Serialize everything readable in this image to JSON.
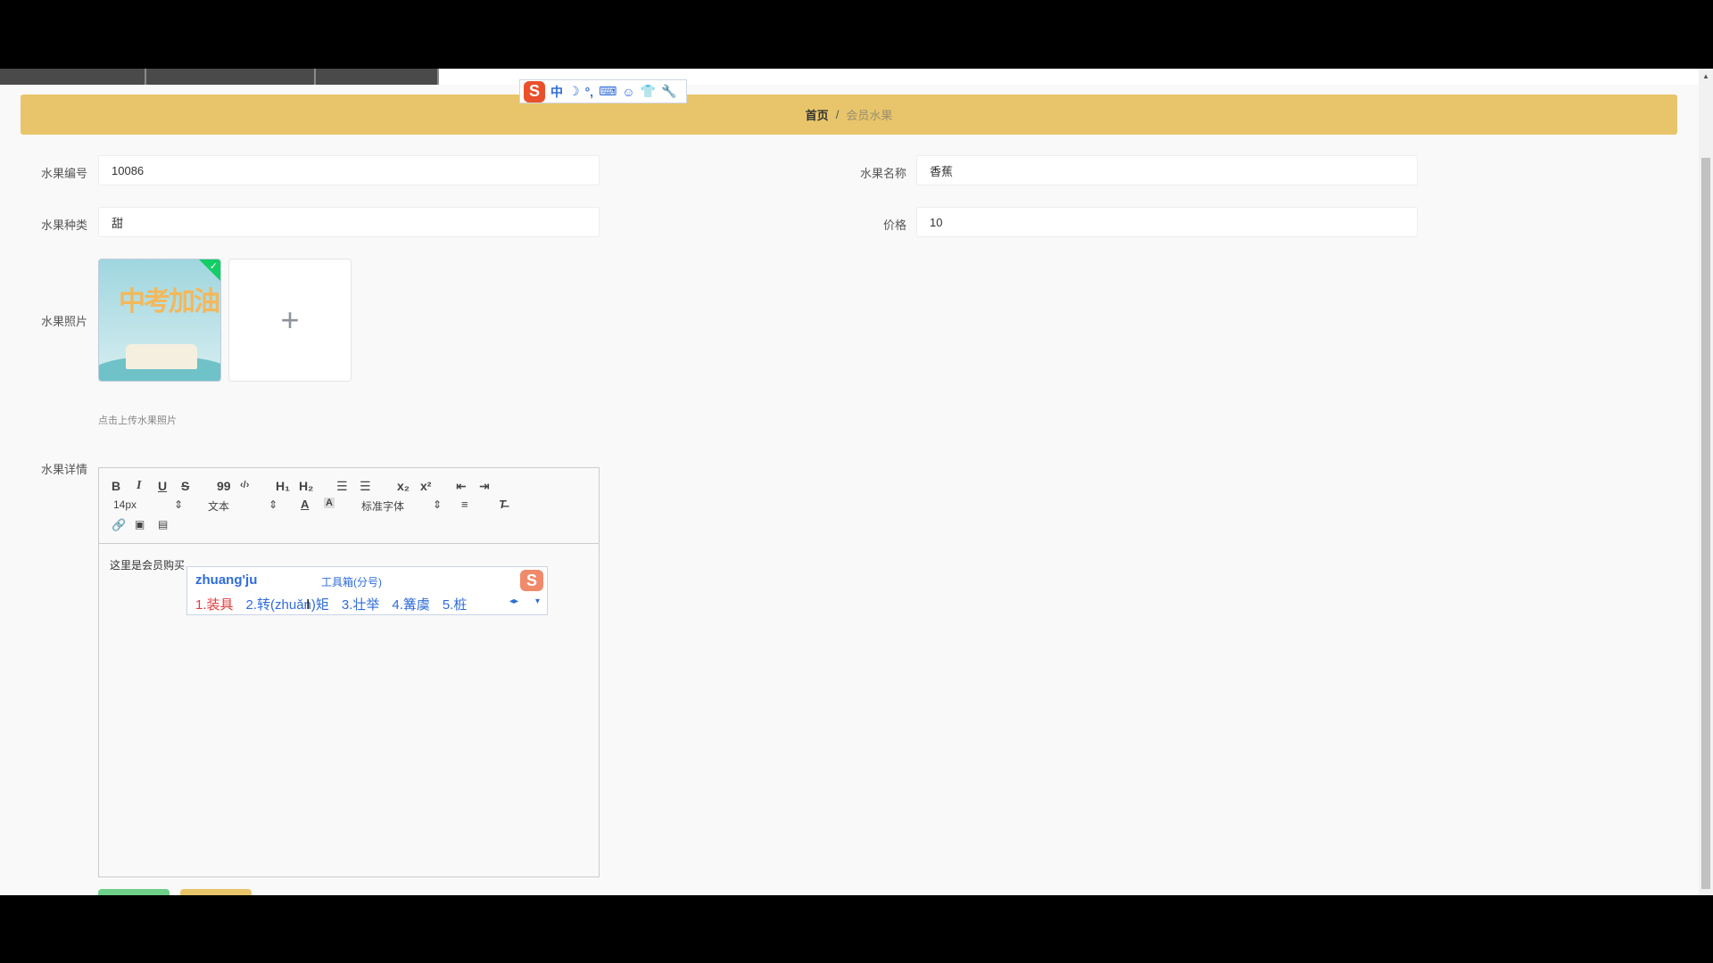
{
  "ime_toolbar": {
    "logo": "S",
    "items": [
      "中",
      "☽",
      "°,",
      "⌨",
      "☺",
      "👕",
      "🔧"
    ]
  },
  "breadcrumb": {
    "home": "首页",
    "separator": "/",
    "current": "会员水果"
  },
  "form": {
    "fruit_id_label": "水果编号",
    "fruit_id_value": "10086",
    "fruit_name_label": "水果名称",
    "fruit_name_value": "香蕉",
    "fruit_type_label": "水果种类",
    "fruit_type_value": "甜",
    "price_label": "价格",
    "price_value": "10",
    "photo_label": "水果照片",
    "photo_thumb_text": "中考加油",
    "upload_plus": "+",
    "upload_tip": "点击上传水果照片",
    "detail_label": "水果详情"
  },
  "editor": {
    "toolbar": {
      "bold": "B",
      "italic": "I",
      "underline": "U",
      "strike": "S",
      "quote": "99",
      "code": "‹/›",
      "h1": "H₁",
      "h2": "H₂",
      "ordered_list": "☰",
      "bullet_list": "☰",
      "sub": "x₂",
      "sup": "x²",
      "outdent": "⇤",
      "indent": "⇥",
      "size_select": "14px",
      "header_select": "文本",
      "font_select": "标准字体"
    },
    "content": "这里是会员购买"
  },
  "ime_popup": {
    "pinyin": "zhuang'ju",
    "tool_hint": "工具箱(分号)",
    "candidates": [
      "1.装具",
      "2.转(zhuǎn)矩",
      "3.壮举",
      "4.篝虞",
      "5.桩"
    ],
    "logo": "S"
  }
}
